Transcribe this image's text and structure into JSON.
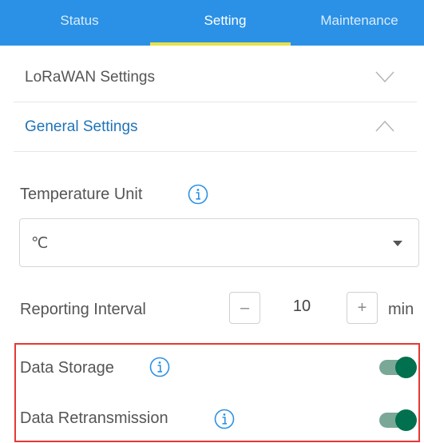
{
  "tabs": {
    "status": "Status",
    "setting": "Setting",
    "maintenance": "Maintenance",
    "active": "Setting"
  },
  "sections": {
    "lorawan": "LoRaWAN Settings",
    "general": "General Settings"
  },
  "temperature": {
    "label": "Temperature Unit",
    "value": "℃"
  },
  "reporting": {
    "label": "Reporting Interval",
    "minus": "–",
    "value": "10",
    "plus": "+",
    "unit": "min"
  },
  "data_storage": {
    "label": "Data Storage",
    "enabled": true
  },
  "data_retransmission": {
    "label": "Data Retransmission",
    "enabled": true
  },
  "colors": {
    "tab_bar": "#2b91e6",
    "tab_indicator": "#e6e24a",
    "section_accent": "#1f74b8",
    "toggle_on": "#00704f",
    "highlight": "#e53935"
  }
}
